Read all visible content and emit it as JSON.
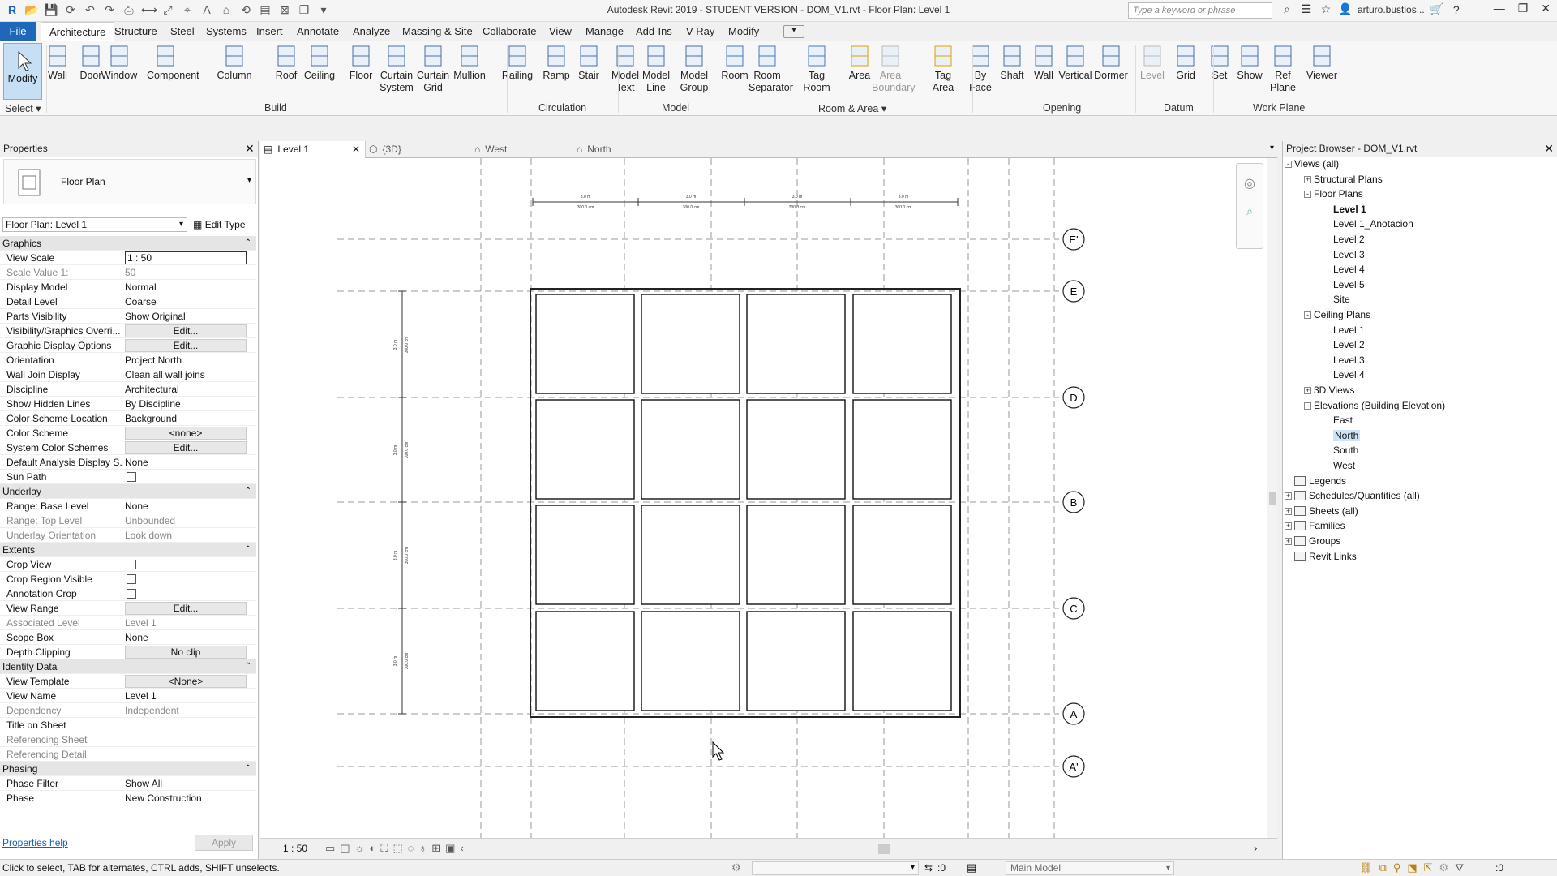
{
  "window_title": "Autodesk Revit 2019 - STUDENT VERSION - DOM_V1.rvt - Floor Plan: Level 1",
  "search_placeholder": "Type a keyword or phrase",
  "user_name": "arturo.bustios...",
  "ribbon_tabs": [
    "File",
    "Architecture",
    "Structure",
    "Steel",
    "Systems",
    "Insert",
    "Annotate",
    "Analyze",
    "Massing & Site",
    "Collaborate",
    "View",
    "Manage",
    "Add-Ins",
    "V-Ray",
    "Modify"
  ],
  "ribbon_buttons": {
    "modify": "Modify",
    "wall": "Wall",
    "door": "Door",
    "window": "Window",
    "component": "Component",
    "column": "Column",
    "roof": "Roof",
    "ceiling": "Ceiling",
    "floor": "Floor",
    "curtain_system": "Curtain\nSystem",
    "curtain_grid": "Curtain\nGrid",
    "mullion": "Mullion",
    "railing": "Railing",
    "ramp": "Ramp",
    "stair": "Stair",
    "model_text": "Model\nText",
    "model_line": "Model\nLine",
    "model_group": "Model\nGroup",
    "room": "Room",
    "room_separator": "Room\nSeparator",
    "tag_room": "Tag\nRoom",
    "area": "Area",
    "area_boundary": "Area\nBoundary",
    "tag_area": "Tag\nArea",
    "by_face": "By\nFace",
    "shaft": "Shaft",
    "wall_opening": "Wall",
    "vertical": "Vertical",
    "dormer": "Dormer",
    "level": "Level",
    "grid": "Grid",
    "set": "Set",
    "show": "Show",
    "ref_plane": "Ref\nPlane",
    "viewer": "Viewer"
  },
  "panels": {
    "select": "Select",
    "build": "Build",
    "circulation": "Circulation",
    "model": "Model",
    "room_area": "Room & Area",
    "opening": "Opening",
    "datum": "Datum",
    "work_plane": "Work Plane"
  },
  "properties": {
    "title": "Properties",
    "type_name": "Floor Plan",
    "instance_selector": "Floor Plan: Level 1",
    "edit_type": "Edit Type",
    "help_link": "Properties help",
    "apply": "Apply",
    "rows": [
      {
        "kind": "section",
        "k": "Graphics"
      },
      {
        "k": "View Scale",
        "v": "1 : 50",
        "kind": "input"
      },
      {
        "k": "Scale Value    1:",
        "v": "50",
        "kind": "grey"
      },
      {
        "k": "Display Model",
        "v": "Normal"
      },
      {
        "k": "Detail Level",
        "v": "Coarse"
      },
      {
        "k": "Parts Visibility",
        "v": "Show Original"
      },
      {
        "k": "Visibility/Graphics Overri...",
        "v": "Edit...",
        "kind": "btn"
      },
      {
        "k": "Graphic Display Options",
        "v": "Edit...",
        "kind": "btn"
      },
      {
        "k": "Orientation",
        "v": "Project North"
      },
      {
        "k": "Wall Join Display",
        "v": "Clean all wall joins"
      },
      {
        "k": "Discipline",
        "v": "Architectural"
      },
      {
        "k": "Show Hidden Lines",
        "v": "By Discipline"
      },
      {
        "k": "Color Scheme Location",
        "v": "Background"
      },
      {
        "k": "Color Scheme",
        "v": "<none>",
        "kind": "btn"
      },
      {
        "k": "System Color Schemes",
        "v": "Edit...",
        "kind": "btn"
      },
      {
        "k": "Default Analysis Display S...",
        "v": "None"
      },
      {
        "k": "Sun Path",
        "v": "",
        "kind": "check"
      },
      {
        "kind": "section",
        "k": "Underlay"
      },
      {
        "k": "Range: Base Level",
        "v": "None"
      },
      {
        "k": "Range: Top Level",
        "v": "Unbounded",
        "kind": "grey"
      },
      {
        "k": "Underlay Orientation",
        "v": "Look down",
        "kind": "grey"
      },
      {
        "kind": "section",
        "k": "Extents"
      },
      {
        "k": "Crop View",
        "v": "",
        "kind": "check"
      },
      {
        "k": "Crop Region Visible",
        "v": "",
        "kind": "check"
      },
      {
        "k": "Annotation Crop",
        "v": "",
        "kind": "check"
      },
      {
        "k": "View Range",
        "v": "Edit...",
        "kind": "btn"
      },
      {
        "k": "Associated Level",
        "v": "Level 1",
        "kind": "grey"
      },
      {
        "k": "Scope Box",
        "v": "None"
      },
      {
        "k": "Depth Clipping",
        "v": "No clip",
        "kind": "btn"
      },
      {
        "kind": "section",
        "k": "Identity Data"
      },
      {
        "k": "View Template",
        "v": "<None>",
        "kind": "btn"
      },
      {
        "k": "View Name",
        "v": "Level 1"
      },
      {
        "k": "Dependency",
        "v": "Independent",
        "kind": "grey"
      },
      {
        "k": "Title on Sheet",
        "v": ""
      },
      {
        "k": "Referencing Sheet",
        "v": "",
        "kind": "grey"
      },
      {
        "k": "Referencing Detail",
        "v": "",
        "kind": "grey"
      },
      {
        "kind": "section",
        "k": "Phasing"
      },
      {
        "k": "Phase Filter",
        "v": "Show All"
      },
      {
        "k": "Phase",
        "v": "New Construction"
      }
    ]
  },
  "view_tabs": [
    {
      "label": "Level 1",
      "active": true
    },
    {
      "label": "{3D}"
    },
    {
      "label": "West"
    },
    {
      "label": "North"
    }
  ],
  "grid_bubbles": [
    "E'",
    "E",
    "D",
    "B",
    "C",
    "A",
    "A'"
  ],
  "dim_top_upper": "3.0 m",
  "dim_top_lower": "300.0 cm",
  "view_scale": "1 : 50",
  "browser": {
    "title": "Project Browser - DOM_V1.rvt",
    "nodes": [
      {
        "label": "Views (all)",
        "lvl": 0,
        "exp": "-"
      },
      {
        "label": "Structural Plans",
        "lvl": 1,
        "exp": "+"
      },
      {
        "label": "Floor Plans",
        "lvl": 1,
        "exp": "-"
      },
      {
        "label": "Level 1",
        "lvl": 2,
        "bold": true
      },
      {
        "label": "Level 1_Anotacion",
        "lvl": 2
      },
      {
        "label": "Level 2",
        "lvl": 2
      },
      {
        "label": "Level 3",
        "lvl": 2
      },
      {
        "label": "Level 4",
        "lvl": 2
      },
      {
        "label": "Level 5",
        "lvl": 2
      },
      {
        "label": "Site",
        "lvl": 2
      },
      {
        "label": "Ceiling Plans",
        "lvl": 1,
        "exp": "-"
      },
      {
        "label": "Level 1",
        "lvl": 2
      },
      {
        "label": "Level 2",
        "lvl": 2
      },
      {
        "label": "Level 3",
        "lvl": 2
      },
      {
        "label": "Level 4",
        "lvl": 2
      },
      {
        "label": "3D Views",
        "lvl": 1,
        "exp": "+"
      },
      {
        "label": "Elevations (Building Elevation)",
        "lvl": 1,
        "exp": "-"
      },
      {
        "label": "East",
        "lvl": 2
      },
      {
        "label": "North",
        "lvl": 2,
        "sel": true
      },
      {
        "label": "South",
        "lvl": 2
      },
      {
        "label": "West",
        "lvl": 2
      },
      {
        "label": "Legends",
        "lvl": 0
      },
      {
        "label": "Schedules/Quantities (all)",
        "lvl": 0,
        "exp": "+"
      },
      {
        "label": "Sheets (all)",
        "lvl": 0,
        "exp": "+"
      },
      {
        "label": "Families",
        "lvl": 0,
        "exp": "+"
      },
      {
        "label": "Groups",
        "lvl": 0,
        "exp": "+"
      },
      {
        "label": "Revit Links",
        "lvl": 0
      }
    ]
  },
  "status": {
    "hint": "Click to select, TAB for alternates, CTRL adds, SHIFT unselects.",
    "workset": ":0",
    "model": "Main Model",
    "filter": ":0"
  },
  "colors": {
    "file_tab": "#1f67b8",
    "brand_logo": "#d0101a",
    "selected": "#cde3f7"
  }
}
